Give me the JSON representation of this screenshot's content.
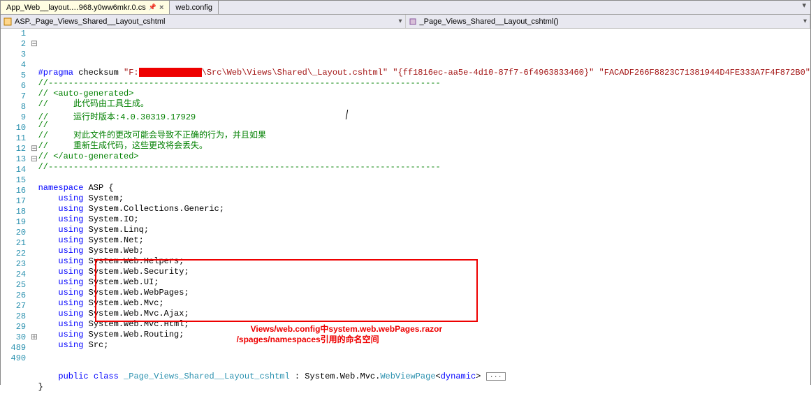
{
  "tabs": [
    {
      "label": "App_Web__layout.…968.y0ww6mkr.0.cs",
      "active": true,
      "pinned": true
    },
    {
      "label": "web.config",
      "active": false
    }
  ],
  "nav": {
    "left": "ASP._Page_Views_Shared__Layout_cshtml",
    "right": "_Page_Views_Shared__Layout_cshtml()"
  },
  "code_lines": [
    {
      "n": 1,
      "fold": "",
      "html": "<span class=\"kw\">#pragma</span> checksum <span class=\"str\">\"F:<span class=\"redact\"></span>\\Src\\Web\\Views\\Shared\\_Layout.cshtml\"</span> <span class=\"str\">\"{ff1816ec-aa5e-4d10-87f7-6f4963833460}\"</span> <span class=\"str\">\"FACADF266F8823C71381944D4FE333A7F4F872B0\"</span>"
    },
    {
      "n": 2,
      "fold": "⊟",
      "html": "<span class=\"cm\">//------------------------------------------------------------------------------</span>"
    },
    {
      "n": 3,
      "fold": "",
      "html": "<span class=\"cm\">// &lt;auto-generated&gt;</span>"
    },
    {
      "n": 4,
      "fold": "",
      "html": "<span class=\"cm\">//     此代码由工具生成。</span>"
    },
    {
      "n": 5,
      "fold": "",
      "html": "<span class=\"cm\">//     运行时版本:4.0.30319.17929</span>                              <span class=\"cursor\"></span>"
    },
    {
      "n": 6,
      "fold": "",
      "html": "<span class=\"cm\">//</span>"
    },
    {
      "n": 7,
      "fold": "",
      "html": "<span class=\"cm\">//     对此文件的更改可能会导致不正确的行为，并且如果</span>"
    },
    {
      "n": 8,
      "fold": "",
      "html": "<span class=\"cm\">//     重新生成代码，这些更改将会丢失。</span>"
    },
    {
      "n": 9,
      "fold": "",
      "html": "<span class=\"cm\">// &lt;/auto-generated&gt;</span>"
    },
    {
      "n": 10,
      "fold": "",
      "html": "<span class=\"cm\">//------------------------------------------------------------------------------</span>"
    },
    {
      "n": 11,
      "fold": "",
      "html": ""
    },
    {
      "n": 12,
      "fold": "⊟",
      "html": "<span class=\"kw\">namespace</span> ASP {"
    },
    {
      "n": 13,
      "fold": "⊟",
      "html": "    <span class=\"kw\">using</span> System;"
    },
    {
      "n": 14,
      "fold": "",
      "html": "    <span class=\"kw\">using</span> System.Collections.Generic;"
    },
    {
      "n": 15,
      "fold": "",
      "html": "    <span class=\"kw\">using</span> System.IO;"
    },
    {
      "n": 16,
      "fold": "",
      "html": "    <span class=\"kw\">using</span> System.Linq;"
    },
    {
      "n": 17,
      "fold": "",
      "html": "    <span class=\"kw\">using</span> System.Net;"
    },
    {
      "n": 18,
      "fold": "",
      "html": "    <span class=\"kw\">using</span> System.Web;"
    },
    {
      "n": 19,
      "fold": "",
      "html": "    <span class=\"kw\">using</span> System.Web.Helpers;"
    },
    {
      "n": 20,
      "fold": "",
      "html": "    <span class=\"kw\">using</span> System.Web.Security;"
    },
    {
      "n": 21,
      "fold": "",
      "html": "    <span class=\"kw\">using</span> System.Web.UI;"
    },
    {
      "n": 22,
      "fold": "",
      "html": "    <span class=\"kw\">using</span> System.Web.WebPages;"
    },
    {
      "n": 23,
      "fold": "",
      "html": "    <span class=\"kw\">using</span> System.Web.Mvc;"
    },
    {
      "n": 24,
      "fold": "",
      "html": "    <span class=\"kw\">using</span> System.Web.Mvc.Ajax;"
    },
    {
      "n": 25,
      "fold": "",
      "html": "    <span class=\"kw\">using</span> System.Web.Mvc.Html;"
    },
    {
      "n": 26,
      "fold": "",
      "html": "    <span class=\"kw\">using</span> System.Web.Routing;"
    },
    {
      "n": 27,
      "fold": "",
      "html": "    <span class=\"kw\">using</span> Src;"
    },
    {
      "n": 28,
      "fold": "",
      "html": ""
    },
    {
      "n": 29,
      "fold": "",
      "html": ""
    },
    {
      "n": 30,
      "fold": "⊞",
      "html": "    <span class=\"kw\">public</span> <span class=\"kw\">class</span> <span class=\"type\">_Page_Views_Shared__Layout_cshtml</span> : System.Web.Mvc.<span class=\"type\">WebViewPage</span>&lt;<span class=\"kw\">dynamic</span>&gt; <span class=\"ellip\">...</span>"
    },
    {
      "n": 489,
      "fold": "",
      "html": "}"
    },
    {
      "n": 490,
      "fold": "",
      "html": ""
    }
  ],
  "annotation": {
    "line1": "Views/web.config中system.web.webPages.razor",
    "line2": "/spages/namespaces引用的命名空间"
  }
}
